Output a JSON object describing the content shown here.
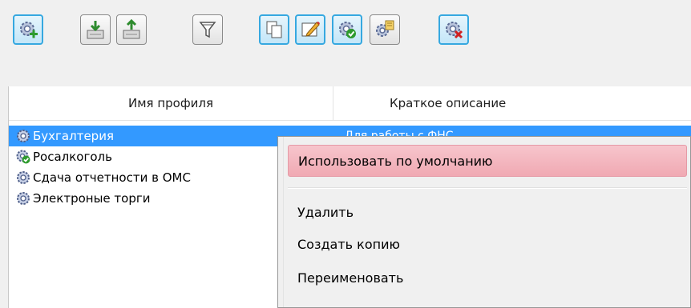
{
  "toolbar": {
    "buttons": [
      {
        "icon": "gear-add-icon",
        "state": "pressed"
      },
      {
        "icon": "import-icon",
        "state": "plain"
      },
      {
        "icon": "export-icon",
        "state": "plain"
      },
      {
        "icon": "filter-icon",
        "state": "plain"
      },
      {
        "icon": "copy-icon",
        "state": "pressed"
      },
      {
        "icon": "edit-icon",
        "state": "pressed"
      },
      {
        "icon": "gear-check-icon",
        "state": "pressed"
      },
      {
        "icon": "gear-properties-icon",
        "state": "plain"
      },
      {
        "icon": "gear-delete-icon",
        "state": "pressed"
      }
    ]
  },
  "list": {
    "columns": {
      "name": "Имя профиля",
      "description": "Краткое описание"
    },
    "rows": [
      {
        "name": "Бухгалтерия",
        "description": "Для работы с ФНС",
        "selected": true,
        "icon": "gear-icon"
      },
      {
        "name": "Росалкоголь",
        "description": "",
        "selected": false,
        "icon": "gear-check-icon"
      },
      {
        "name": "Сдача отчетности в ОМС",
        "description": "",
        "selected": false,
        "icon": "gear-icon"
      },
      {
        "name": "Электроные торги",
        "description": "",
        "selected": false,
        "icon": "gear-icon"
      }
    ]
  },
  "context_menu": {
    "items": [
      {
        "label": "Использовать по умолчанию",
        "highlighted": true
      },
      {
        "label": "Удалить",
        "highlighted": false
      },
      {
        "label": "Создать копию",
        "highlighted": false
      },
      {
        "label": "Переименовать",
        "highlighted": false
      }
    ]
  },
  "colors": {
    "selection": "#3399ff",
    "menu_hover": "#f2b4bd",
    "pressed_border": "#36a8e0"
  }
}
